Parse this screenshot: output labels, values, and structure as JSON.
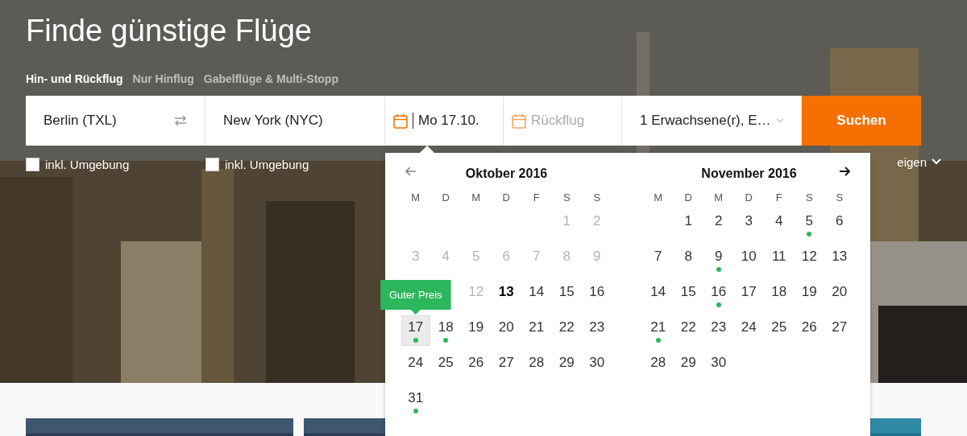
{
  "title": "Finde günstige Flüge",
  "trip_tabs": [
    {
      "label": "Hin- und Rückflug",
      "selected": true
    },
    {
      "label": "Nur Hinflug",
      "selected": false
    },
    {
      "label": "Gabelflüge & Multi-Stopp",
      "selected": false
    }
  ],
  "search": {
    "origin": "Berlin (TXL)",
    "destination": "New York (NYC)",
    "departure": "Mo 17.10.",
    "return_placeholder": "Rückflug",
    "passengers": "1 Erwachsene(r), E…",
    "button": "Suchen"
  },
  "nearby_options": [
    {
      "label": "inkl. Umgebung",
      "checked": false
    },
    {
      "label": "inkl. Umgebung",
      "checked": false
    }
  ],
  "more_link": "eigen",
  "calendar": {
    "months": [
      {
        "title": "Oktober 2016",
        "weekdays": [
          "M",
          "D",
          "M",
          "D",
          "F",
          "S",
          "S"
        ],
        "weeks": [
          {
            "starts_midweek": true,
            "days": [
              {
                "d": "1",
                "disabled": true,
                "today": false,
                "selected": false,
                "deal": false
              },
              {
                "d": "2",
                "disabled": true,
                "today": false,
                "selected": false,
                "deal": false
              }
            ]
          },
          {
            "starts_midweek": false,
            "days": [
              {
                "d": "3",
                "disabled": true,
                "today": false,
                "selected": false,
                "deal": false
              },
              {
                "d": "4",
                "disabled": true,
                "today": false,
                "selected": false,
                "deal": false
              },
              {
                "d": "5",
                "disabled": true,
                "today": false,
                "selected": false,
                "deal": false
              },
              {
                "d": "6",
                "disabled": true,
                "today": false,
                "selected": false,
                "deal": false
              },
              {
                "d": "7",
                "disabled": true,
                "today": false,
                "selected": false,
                "deal": false
              },
              {
                "d": "8",
                "disabled": true,
                "today": false,
                "selected": false,
                "deal": false
              },
              {
                "d": "9",
                "disabled": true,
                "today": false,
                "selected": false,
                "deal": false
              }
            ]
          },
          {
            "starts_midweek": true,
            "days": [
              {
                "d": "12",
                "disabled": true,
                "today": false,
                "selected": false,
                "deal": false
              },
              {
                "d": "13",
                "disabled": false,
                "today": true,
                "selected": false,
                "deal": false
              },
              {
                "d": "14",
                "disabled": false,
                "today": false,
                "selected": false,
                "deal": false
              },
              {
                "d": "15",
                "disabled": false,
                "today": false,
                "selected": false,
                "deal": false
              },
              {
                "d": "16",
                "disabled": false,
                "today": false,
                "selected": false,
                "deal": false
              }
            ]
          },
          {
            "starts_midweek": false,
            "days": [
              {
                "d": "17",
                "disabled": false,
                "today": false,
                "selected": true,
                "deal": true,
                "tooltip": "Guter Preis"
              },
              {
                "d": "18",
                "disabled": false,
                "today": false,
                "selected": false,
                "deal": true
              },
              {
                "d": "19",
                "disabled": false,
                "today": false,
                "selected": false,
                "deal": false
              },
              {
                "d": "20",
                "disabled": false,
                "today": false,
                "selected": false,
                "deal": false
              },
              {
                "d": "21",
                "disabled": false,
                "today": false,
                "selected": false,
                "deal": false
              },
              {
                "d": "22",
                "disabled": false,
                "today": false,
                "selected": false,
                "deal": false
              },
              {
                "d": "23",
                "disabled": false,
                "today": false,
                "selected": false,
                "deal": false
              }
            ]
          },
          {
            "starts_midweek": false,
            "days": [
              {
                "d": "24",
                "disabled": false,
                "today": false,
                "selected": false,
                "deal": false
              },
              {
                "d": "25",
                "disabled": false,
                "today": false,
                "selected": false,
                "deal": false
              },
              {
                "d": "26",
                "disabled": false,
                "today": false,
                "selected": false,
                "deal": false
              },
              {
                "d": "27",
                "disabled": false,
                "today": false,
                "selected": false,
                "deal": false
              },
              {
                "d": "28",
                "disabled": false,
                "today": false,
                "selected": false,
                "deal": false
              },
              {
                "d": "29",
                "disabled": false,
                "today": false,
                "selected": false,
                "deal": false
              },
              {
                "d": "30",
                "disabled": false,
                "today": false,
                "selected": false,
                "deal": false
              }
            ]
          },
          {
            "starts_midweek": false,
            "days": [
              {
                "d": "31",
                "disabled": false,
                "today": false,
                "selected": false,
                "deal": true
              }
            ]
          }
        ]
      },
      {
        "title": "November 2016",
        "weekdays": [
          "M",
          "D",
          "M",
          "D",
          "F",
          "S",
          "S"
        ],
        "weeks": [
          {
            "starts_midweek": true,
            "days": [
              {
                "d": "1",
                "disabled": false,
                "today": false,
                "selected": false,
                "deal": false
              },
              {
                "d": "2",
                "disabled": false,
                "today": false,
                "selected": false,
                "deal": false
              },
              {
                "d": "3",
                "disabled": false,
                "today": false,
                "selected": false,
                "deal": false
              },
              {
                "d": "4",
                "disabled": false,
                "today": false,
                "selected": false,
                "deal": false
              },
              {
                "d": "5",
                "disabled": false,
                "today": false,
                "selected": false,
                "deal": true
              },
              {
                "d": "6",
                "disabled": false,
                "today": false,
                "selected": false,
                "deal": false
              }
            ]
          },
          {
            "starts_midweek": false,
            "days": [
              {
                "d": "7",
                "disabled": false,
                "today": false,
                "selected": false,
                "deal": false
              },
              {
                "d": "8",
                "disabled": false,
                "today": false,
                "selected": false,
                "deal": false
              },
              {
                "d": "9",
                "disabled": false,
                "today": false,
                "selected": false,
                "deal": true
              },
              {
                "d": "10",
                "disabled": false,
                "today": false,
                "selected": false,
                "deal": false
              },
              {
                "d": "11",
                "disabled": false,
                "today": false,
                "selected": false,
                "deal": false
              },
              {
                "d": "12",
                "disabled": false,
                "today": false,
                "selected": false,
                "deal": false
              },
              {
                "d": "13",
                "disabled": false,
                "today": false,
                "selected": false,
                "deal": false
              }
            ]
          },
          {
            "starts_midweek": false,
            "days": [
              {
                "d": "14",
                "disabled": false,
                "today": false,
                "selected": false,
                "deal": false
              },
              {
                "d": "15",
                "disabled": false,
                "today": false,
                "selected": false,
                "deal": false
              },
              {
                "d": "16",
                "disabled": false,
                "today": false,
                "selected": false,
                "deal": true
              },
              {
                "d": "17",
                "disabled": false,
                "today": false,
                "selected": false,
                "deal": false
              },
              {
                "d": "18",
                "disabled": false,
                "today": false,
                "selected": false,
                "deal": false
              },
              {
                "d": "19",
                "disabled": false,
                "today": false,
                "selected": false,
                "deal": false
              },
              {
                "d": "20",
                "disabled": false,
                "today": false,
                "selected": false,
                "deal": false
              }
            ]
          },
          {
            "starts_midweek": false,
            "days": [
              {
                "d": "21",
                "disabled": false,
                "today": false,
                "selected": false,
                "deal": true
              },
              {
                "d": "22",
                "disabled": false,
                "today": false,
                "selected": false,
                "deal": false
              },
              {
                "d": "23",
                "disabled": false,
                "today": false,
                "selected": false,
                "deal": false
              },
              {
                "d": "24",
                "disabled": false,
                "today": false,
                "selected": false,
                "deal": false
              },
              {
                "d": "25",
                "disabled": false,
                "today": false,
                "selected": false,
                "deal": false
              },
              {
                "d": "26",
                "disabled": false,
                "today": false,
                "selected": false,
                "deal": false
              },
              {
                "d": "27",
                "disabled": false,
                "today": false,
                "selected": false,
                "deal": false
              }
            ]
          },
          {
            "starts_midweek": false,
            "days": [
              {
                "d": "28",
                "disabled": false,
                "today": false,
                "selected": false,
                "deal": false
              },
              {
                "d": "29",
                "disabled": false,
                "today": false,
                "selected": false,
                "deal": false
              },
              {
                "d": "30",
                "disabled": false,
                "today": false,
                "selected": false,
                "deal": false
              }
            ]
          }
        ]
      }
    ]
  }
}
